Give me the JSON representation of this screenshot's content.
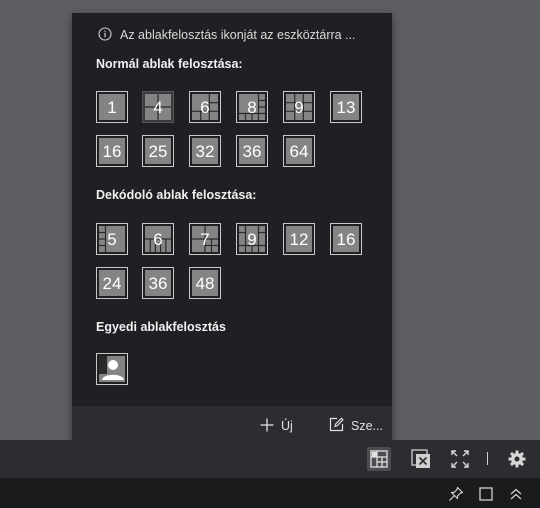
{
  "popup": {
    "hint_text": "Az ablakfelosztás ikonját az eszköztárra ...",
    "normal_title": "Normál ablak felosztása:",
    "normal_layouts": [
      "1",
      "4",
      "6",
      "8",
      "9",
      "13",
      "16",
      "25",
      "32",
      "36",
      "64"
    ],
    "selected_layout": "4",
    "decoder_title": "Dekódoló ablak felosztása:",
    "decoder_layouts": [
      "5",
      "6",
      "7",
      "9",
      "12",
      "16",
      "24",
      "36",
      "48"
    ],
    "custom_title": "Egyedi ablakfelosztás",
    "footer": {
      "new_label": "Új",
      "edit_label": "Sze..."
    }
  },
  "toolbar": {
    "icons": [
      "window-layout-icon",
      "close-all-windows-icon",
      "fullscreen-icon",
      "settings-icon"
    ]
  },
  "statusbar": {
    "icons": [
      "pin-icon",
      "maximize-icon",
      "collapse-icon"
    ]
  },
  "colors": {
    "background": "#5e5f63",
    "popup": "#1f2023",
    "footer": "#2b2d30",
    "tile": "#848484",
    "tile_border": "#c9c9c9"
  }
}
